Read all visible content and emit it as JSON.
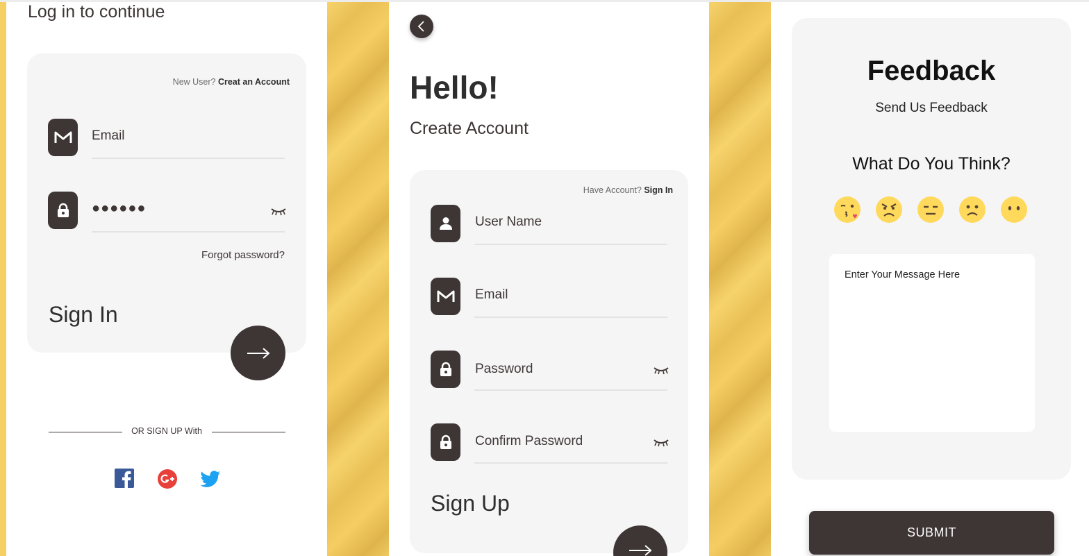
{
  "login": {
    "subtitle": "Log in to continue",
    "new_user_prefix": "New User? ",
    "create_account_link": "Creat an Account",
    "email_label": "Email",
    "password_value": "●●●●●●",
    "forgot_password": "Forgot password?",
    "sign_in_title": "Sign In",
    "or_sign_up_with": "OR SIGN UP With",
    "socials": [
      "facebook",
      "google-plus",
      "twitter"
    ]
  },
  "signup": {
    "title": "Hello!",
    "subtitle": "Create Account",
    "have_account_prefix": "Have Account? ",
    "sign_in_link": "Sign In",
    "username_label": "User Name",
    "email_label": "Email",
    "password_label": "Password",
    "confirm_password_label": "Confirm Password",
    "sign_up_title": "Sign Up"
  },
  "feedback": {
    "title": "Feedback",
    "subtitle": "Send Us Feedback",
    "question": "What Do You Think?",
    "emojis": [
      "kissing-face",
      "angry-face",
      "expressionless-face",
      "frowning-face",
      "no-mouth-face"
    ],
    "message_placeholder": "Enter Your Message Here",
    "submit_label": "SUBMIT"
  },
  "colors": {
    "dark": "#3e3535",
    "card": "#f5f5f5",
    "gold": "#f6cf62",
    "emoji": "#ffd95c"
  }
}
